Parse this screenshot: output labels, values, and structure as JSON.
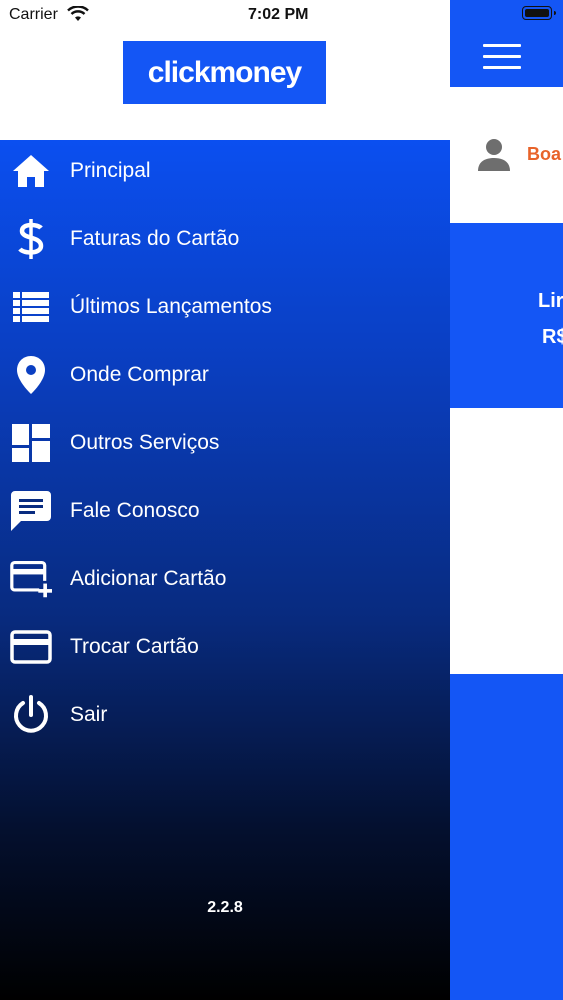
{
  "status_bar": {
    "carrier": "Carrier",
    "time": "7:02 PM"
  },
  "drawer": {
    "logo_text": "clickmoney",
    "items": [
      {
        "label": "Principal",
        "icon": "home-icon"
      },
      {
        "label": "Faturas do Cartão",
        "icon": "dollar-icon"
      },
      {
        "label": "Últimos Lançamentos",
        "icon": "list-icon"
      },
      {
        "label": "Onde Comprar",
        "icon": "location-pin-icon"
      },
      {
        "label": "Outros Serviços",
        "icon": "dashboard-icon"
      },
      {
        "label": "Fale Conosco",
        "icon": "chat-icon"
      },
      {
        "label": "Adicionar Cartão",
        "icon": "add-card-icon"
      },
      {
        "label": "Trocar Cartão",
        "icon": "credit-card-icon"
      },
      {
        "label": "Sair",
        "icon": "power-icon"
      }
    ],
    "version": "2.2.8"
  },
  "main": {
    "greeting": "Boa",
    "limit_label": "Lir",
    "limit_value": "R$"
  },
  "colors": {
    "brand_blue": "#1456f5",
    "greeting_orange": "#e8632a"
  }
}
